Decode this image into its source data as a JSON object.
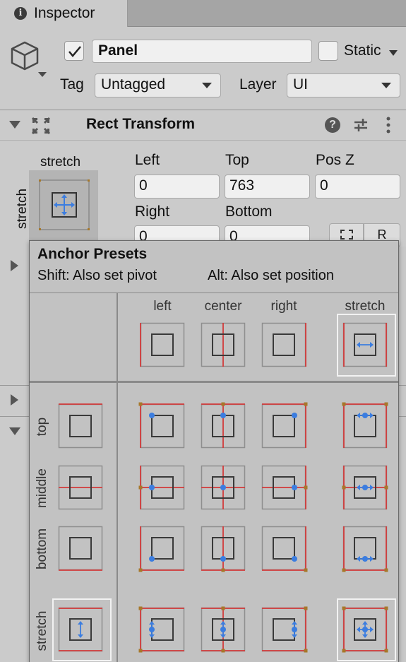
{
  "tab": {
    "icon": "info-icon",
    "label": "Inspector"
  },
  "header": {
    "active": true,
    "name": "Panel",
    "static_label": "Static",
    "tag_label": "Tag",
    "tag_value": "Untagged",
    "layer_label": "Layer",
    "layer_value": "UI"
  },
  "rect_transform": {
    "title": "Rect Transform",
    "anchor_h": "stretch",
    "anchor_v": "stretch",
    "fields": {
      "left_label": "Left",
      "left": "0",
      "top_label": "Top",
      "top": "763",
      "posz_label": "Pos Z",
      "posz": "0",
      "right_label": "Right",
      "right": "0",
      "bottom_label": "Bottom",
      "bottom": "0"
    }
  },
  "popup": {
    "title": "Anchor Presets",
    "hint_shift": "Shift: Also set pivot",
    "hint_alt": "Alt: Also set position",
    "columns": [
      "left",
      "center",
      "right",
      "stretch"
    ],
    "rows": [
      "top",
      "middle",
      "bottom",
      "stretch"
    ]
  },
  "colors": {
    "anchor_line": "#d23a3a",
    "anchor_handle": "#a7782a",
    "pivot": "#3b7de0",
    "selected_outline": "#f2f2f2"
  }
}
